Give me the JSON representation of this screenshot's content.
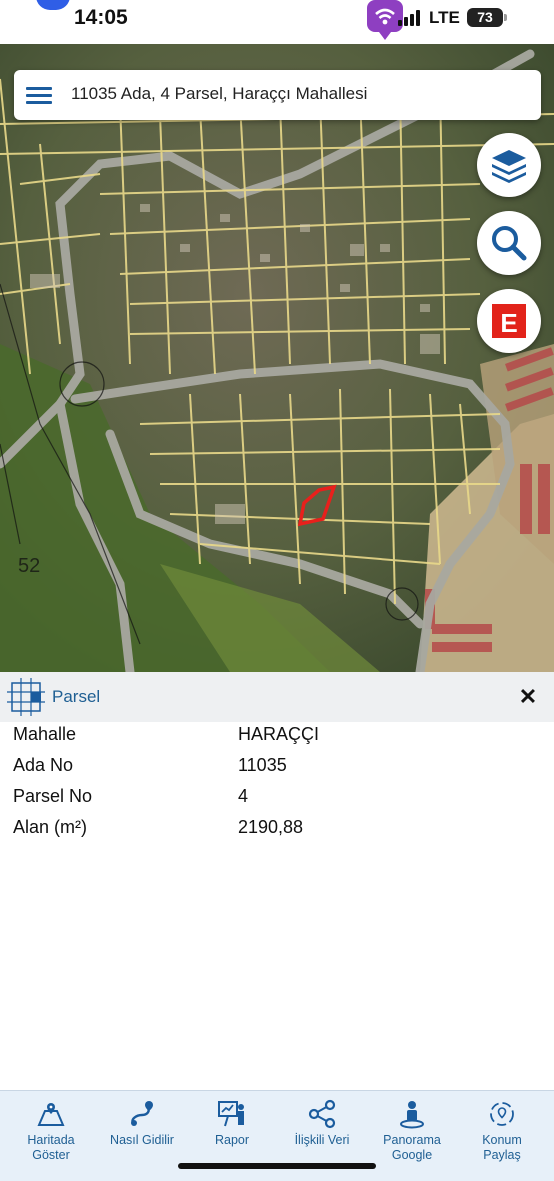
{
  "status_bar": {
    "time": "14:05",
    "network": "LTE",
    "battery": "73"
  },
  "search": {
    "query": "11035 Ada, 4 Parsel, Haraççı Mahallesi"
  },
  "map": {
    "layers_icon": "layers-icon",
    "zoom_icon": "search-icon",
    "e_label": "E"
  },
  "panel": {
    "title": "Parsel",
    "close": "✕",
    "rows": [
      {
        "key": "Mahalle",
        "value": "HARAÇÇI"
      },
      {
        "key": "Ada No",
        "value": "11035"
      },
      {
        "key": "Parsel No",
        "value": "4"
      },
      {
        "key": "Alan (m²)",
        "value": "2190,88"
      }
    ]
  },
  "toolbar": {
    "items": [
      {
        "label_1": "Haritada",
        "label_2": "Göster",
        "icon": "map-pin-icon"
      },
      {
        "label_1": "Nasıl Gidilir",
        "label_2": "",
        "icon": "route-icon"
      },
      {
        "label_1": "Rapor",
        "label_2": "",
        "icon": "presentation-icon"
      },
      {
        "label_1": "İlişkili Veri",
        "label_2": "",
        "icon": "share-icon"
      },
      {
        "label_1": "Panorama",
        "label_2": "Google",
        "icon": "person-icon"
      },
      {
        "label_1": "Konum",
        "label_2": "Paylaş",
        "icon": "location-share-icon"
      }
    ]
  },
  "colors": {
    "accent": "#1f5f93",
    "parcel_line": "#e9d98a",
    "highlight": "#e8201c",
    "e_badge": "#e2231a"
  }
}
